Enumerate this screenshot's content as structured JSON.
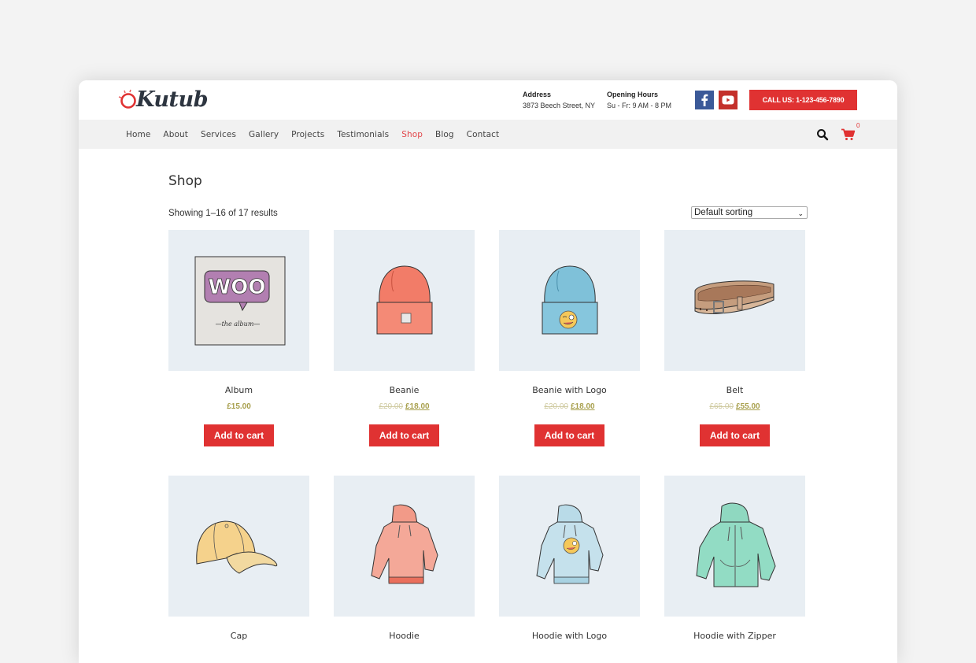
{
  "header": {
    "logo_text": "Kutub",
    "address_label": "Address",
    "address_value": "3873 Beech Street, NY",
    "hours_label": "Opening Hours",
    "hours_value": "Su - Fr: 9 AM - 8 PM",
    "social": [
      {
        "name": "facebook-icon",
        "glyph": "f"
      },
      {
        "name": "youtube-icon",
        "glyph": "▶"
      }
    ],
    "call_button": "CALL US: 1-123-456-7890"
  },
  "nav": {
    "items": [
      {
        "label": "Home",
        "active": false
      },
      {
        "label": "About",
        "active": false
      },
      {
        "label": "Services",
        "active": false
      },
      {
        "label": "Gallery",
        "active": false
      },
      {
        "label": "Projects",
        "active": false
      },
      {
        "label": "Testimonials",
        "active": false
      },
      {
        "label": "Shop",
        "active": true
      },
      {
        "label": "Blog",
        "active": false
      },
      {
        "label": "Contact",
        "active": false
      }
    ],
    "cart_count": "0",
    "icons": {
      "search": "search-icon",
      "cart": "cart-icon"
    }
  },
  "shop": {
    "title": "Shop",
    "result_count": "Showing 1–16 of 17 results",
    "sort_selected": "Default sorting",
    "add_to_cart_label": "Add to cart",
    "products": [
      {
        "name": "Album",
        "price": "£15.00",
        "old_price": null,
        "image": "album"
      },
      {
        "name": "Beanie",
        "price": "£18.00",
        "old_price": "£20.00",
        "image": "beanie"
      },
      {
        "name": "Beanie with Logo",
        "price": "£18.00",
        "old_price": "£20.00",
        "image": "beanie-logo"
      },
      {
        "name": "Belt",
        "price": "£55.00",
        "old_price": "£65.00",
        "image": "belt"
      },
      {
        "name": "Cap",
        "price": null,
        "old_price": null,
        "image": "cap"
      },
      {
        "name": "Hoodie",
        "price": null,
        "old_price": null,
        "image": "hoodie"
      },
      {
        "name": "Hoodie with Logo",
        "price": null,
        "old_price": null,
        "image": "hoodie-logo"
      },
      {
        "name": "Hoodie with Zipper",
        "price": null,
        "old_price": null,
        "image": "hoodie-zipper"
      }
    ]
  },
  "colors": {
    "accent": "#e03232",
    "price": "#a8a04e",
    "nav_active": "#e2474b",
    "thumb_bg": "#e8eef3"
  }
}
